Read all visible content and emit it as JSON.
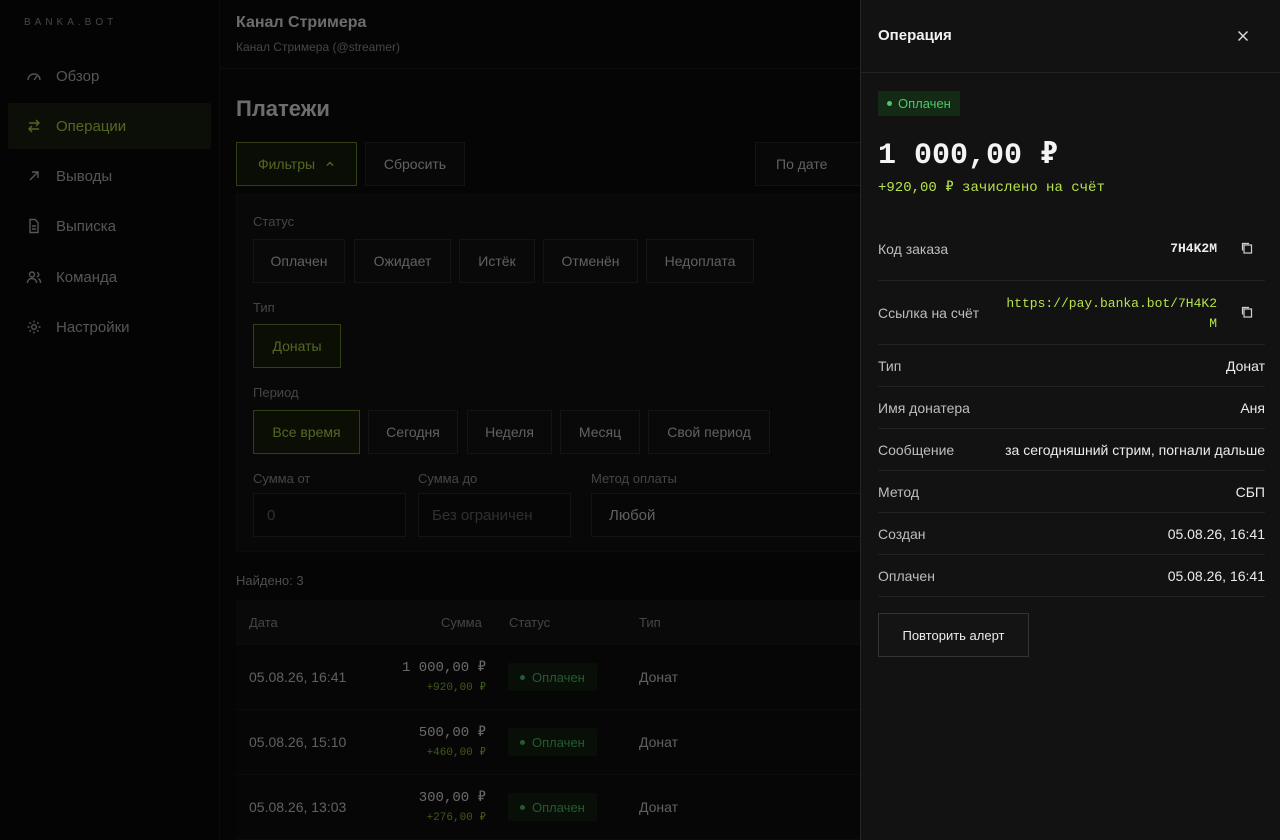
{
  "brand": "BANKA.BOT",
  "sidebar": {
    "items": [
      {
        "label": "Обзор",
        "icon": "gauge-icon"
      },
      {
        "label": "Операции",
        "icon": "swap-arrows-icon",
        "active": true
      },
      {
        "label": "Выводы",
        "icon": "arrow-up-right-icon"
      },
      {
        "label": "Выписка",
        "icon": "document-icon"
      },
      {
        "label": "Команда",
        "icon": "users-icon"
      },
      {
        "label": "Настройки",
        "icon": "gear-icon"
      }
    ]
  },
  "header": {
    "channel_title": "Канал Стримера",
    "channel_subtitle": "Канал Стримера (@streamer)"
  },
  "page": {
    "title": "Платежи",
    "filters_label": "Фильтры",
    "reset_label": "Сбросить",
    "sort_label": "По дате"
  },
  "filters": {
    "status_label": "Статус",
    "statuses": [
      "Оплачен",
      "Ожидает",
      "Истёк",
      "Отменён",
      "Недоплата"
    ],
    "type_label": "Тип",
    "types": [
      "Донаты"
    ],
    "period_label": "Период",
    "periods": [
      "Все время",
      "Сегодня",
      "Неделя",
      "Месяц",
      "Свой период"
    ],
    "amount_from_label": "Сумма от",
    "amount_from_placeholder": "0",
    "amount_to_label": "Сумма до",
    "amount_to_placeholder": "Без ограничен",
    "method_label": "Метод оплаты",
    "method_value": "Любой"
  },
  "results": {
    "found": "Найдено: 3",
    "columns": [
      "Дата",
      "Сумма",
      "Статус",
      "Тип"
    ],
    "rows": [
      {
        "date": "05.08.26, 16:41",
        "amount": "1 000,00 ₽",
        "credited": "+920,00 ₽",
        "status": "Оплачен",
        "type": "Донат"
      },
      {
        "date": "05.08.26, 15:10",
        "amount": "500,00 ₽",
        "credited": "+460,00 ₽",
        "status": "Оплачен",
        "type": "Донат"
      },
      {
        "date": "05.08.26, 13:03",
        "amount": "300,00 ₽",
        "credited": "+276,00 ₽",
        "status": "Оплачен",
        "type": "Донат"
      }
    ]
  },
  "drawer": {
    "title": "Операция",
    "status": "Оплачен",
    "amount": "1 000,00 ₽",
    "credited": "+920,00 ₽ зачислено на счёт",
    "order_code_label": "Код заказа",
    "order_code": "7H4K2M",
    "link_label": "Ссылка на счёт",
    "link_line1": "https://pay.banka.bot/7H4K2",
    "link_line2": "M",
    "fields": [
      {
        "k": "Тип",
        "v": "Донат"
      },
      {
        "k": "Имя донатера",
        "v": "Аня"
      },
      {
        "k": "Сообщение",
        "v": "за сегодняшний стрим, погнали дальше"
      },
      {
        "k": "Метод",
        "v": "СБП"
      },
      {
        "k": "Создан",
        "v": "05.08.26, 16:41"
      },
      {
        "k": "Оплачен",
        "v": "05.08.26, 16:41"
      }
    ],
    "repeat_label": "Повторить алерт"
  },
  "colors": {
    "accent": "#b6e24a",
    "success": "#4fc86a",
    "background": "#0b0b0b"
  }
}
